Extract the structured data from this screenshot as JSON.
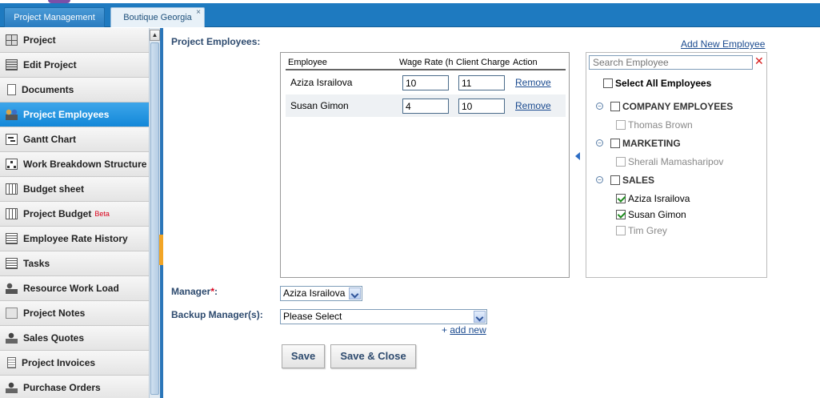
{
  "tabs": [
    {
      "label": "Project Management"
    },
    {
      "label": "Boutique Georgia",
      "close": "×"
    }
  ],
  "sidebar": {
    "items": [
      {
        "label": "Project",
        "icon": "grid-icon"
      },
      {
        "label": "Edit Project",
        "icon": "edit-icon"
      },
      {
        "label": "Documents",
        "icon": "document-icon"
      },
      {
        "label": "Project Employees",
        "icon": "people-icon",
        "active": true
      },
      {
        "label": "Gantt Chart",
        "icon": "gantt-icon"
      },
      {
        "label": "Work Breakdown Structure",
        "icon": "tree-icon"
      },
      {
        "label": "Budget sheet",
        "icon": "sheet-icon"
      },
      {
        "label": "Project Budget",
        "icon": "sheet-icon",
        "badge": "Beta"
      },
      {
        "label": "Employee Rate History",
        "icon": "list-icon"
      },
      {
        "label": "Tasks",
        "icon": "list-icon"
      },
      {
        "label": "Resource Work Load",
        "icon": "resource-icon"
      },
      {
        "label": "Project Notes",
        "icon": "note-icon"
      },
      {
        "label": "Sales Quotes",
        "icon": "quote-icon"
      },
      {
        "label": "Project Invoices",
        "icon": "invoice-icon"
      },
      {
        "label": "Purchase Orders",
        "icon": "quote-icon"
      }
    ]
  },
  "main": {
    "title": "Project Employees:",
    "add_new_employee": "Add New Employee",
    "table": {
      "headers": [
        "Employee",
        "Wage Rate (h",
        "Client Charge",
        "Action"
      ],
      "rows": [
        {
          "employee": "Aziza Israilova",
          "wage_rate": "10",
          "client_charge": "11",
          "action": "Remove"
        },
        {
          "employee": "Susan Gimon",
          "wage_rate": "4",
          "client_charge": "10",
          "action": "Remove"
        }
      ]
    },
    "selector": {
      "search_placeholder": "Search Employee",
      "select_all": "Select All Employees",
      "groups": [
        {
          "name": "COMPANY EMPLOYEES",
          "members": [
            {
              "name": "Thomas Brown",
              "checked": false
            }
          ]
        },
        {
          "name": "MARKETING",
          "members": [
            {
              "name": "Sherali Mamasharipov",
              "checked": false
            }
          ]
        },
        {
          "name": "SALES",
          "members": [
            {
              "name": "Aziza Israilova",
              "checked": true
            },
            {
              "name": "Susan Gimon",
              "checked": true
            },
            {
              "name": "Tim Grey",
              "checked": false
            }
          ]
        }
      ]
    },
    "manager_label": "Manager",
    "required_mark": "*",
    "manager_suffix": ":",
    "manager_value": "Aziza Israilova",
    "backup_label": "Backup Manager(s):",
    "backup_value": "Please Select",
    "add_new_plus": "+",
    "add_new": "add new",
    "save": "Save",
    "save_close": "Save & Close"
  }
}
